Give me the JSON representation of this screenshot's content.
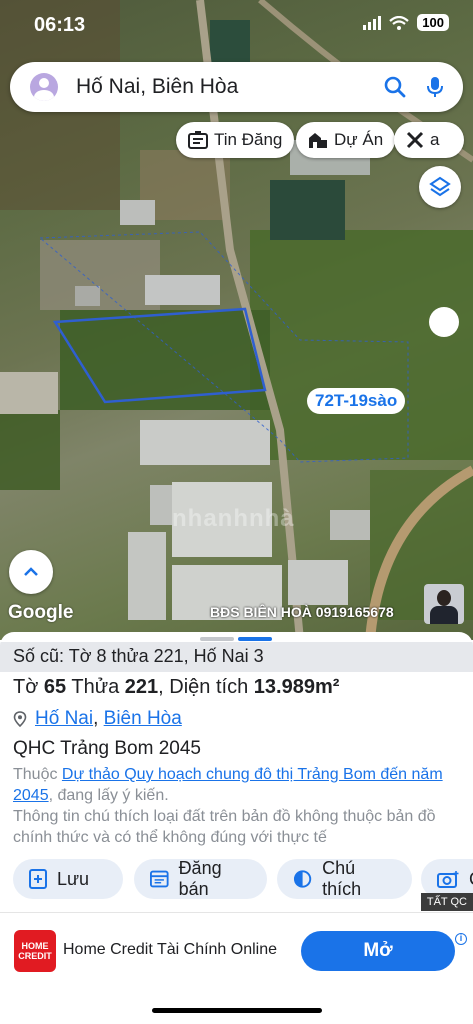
{
  "status_bar": {
    "time": "06:13",
    "battery": "100"
  },
  "search": {
    "query": "Hố Nai, Biên Hòa"
  },
  "chips": [
    {
      "label": "Tin Đăng",
      "icon": "listing-icon"
    },
    {
      "label": "Dự Án",
      "icon": "building-icon"
    },
    {
      "label": "a",
      "icon": "tools-icon"
    }
  ],
  "map": {
    "parcel_label": "72T-19sào",
    "google_logo": "Google",
    "watermark_agent": "BĐS BIÊN HOÀ 0919165678",
    "map_watermark": "nhanhnhà"
  },
  "sheet": {
    "old_parcel": "Số cũ: Tờ 8 thửa 221, Hố Nai 3",
    "sheet_prefix": "Tờ",
    "sheet_no": "65",
    "parcel_prefix": "Thửa",
    "parcel_no": "221",
    "area_prefix": "Diện tích",
    "area": "13.989m²",
    "ward": "Hố Nai",
    "city": "Biên Hòa",
    "plan_title": "QHC Trảng Bom 2045",
    "plan_note_prefix": "Thuộc",
    "plan_note_link": "Dự thảo Quy hoạch chung đô thị Trảng Bom đến năm 2045",
    "plan_note_suffix": ", đang lấy ý kiến.",
    "disclaimer": "Thông tin chú thích loại đất trên bản đồ không thuộc bản đồ chính thức và có thể không đúng với thực tế"
  },
  "actions": [
    {
      "label": "Lưu",
      "icon": "save-add-icon"
    },
    {
      "label": "Đăng bán",
      "icon": "post-sale-icon"
    },
    {
      "label": "Chú thích",
      "icon": "legend-icon"
    },
    {
      "label": "C",
      "icon": "camera-icon"
    }
  ],
  "ad": {
    "tag": "TẤT QC",
    "logo_text": "HOME CREDIT",
    "title": "Home Credit Tài Chính Online",
    "cta": "Mở",
    "info_icon": "i"
  },
  "colors": {
    "accent": "#1a73e8",
    "parcel_outline": "#2f5fd0",
    "ad_brand": "#e11b22"
  }
}
